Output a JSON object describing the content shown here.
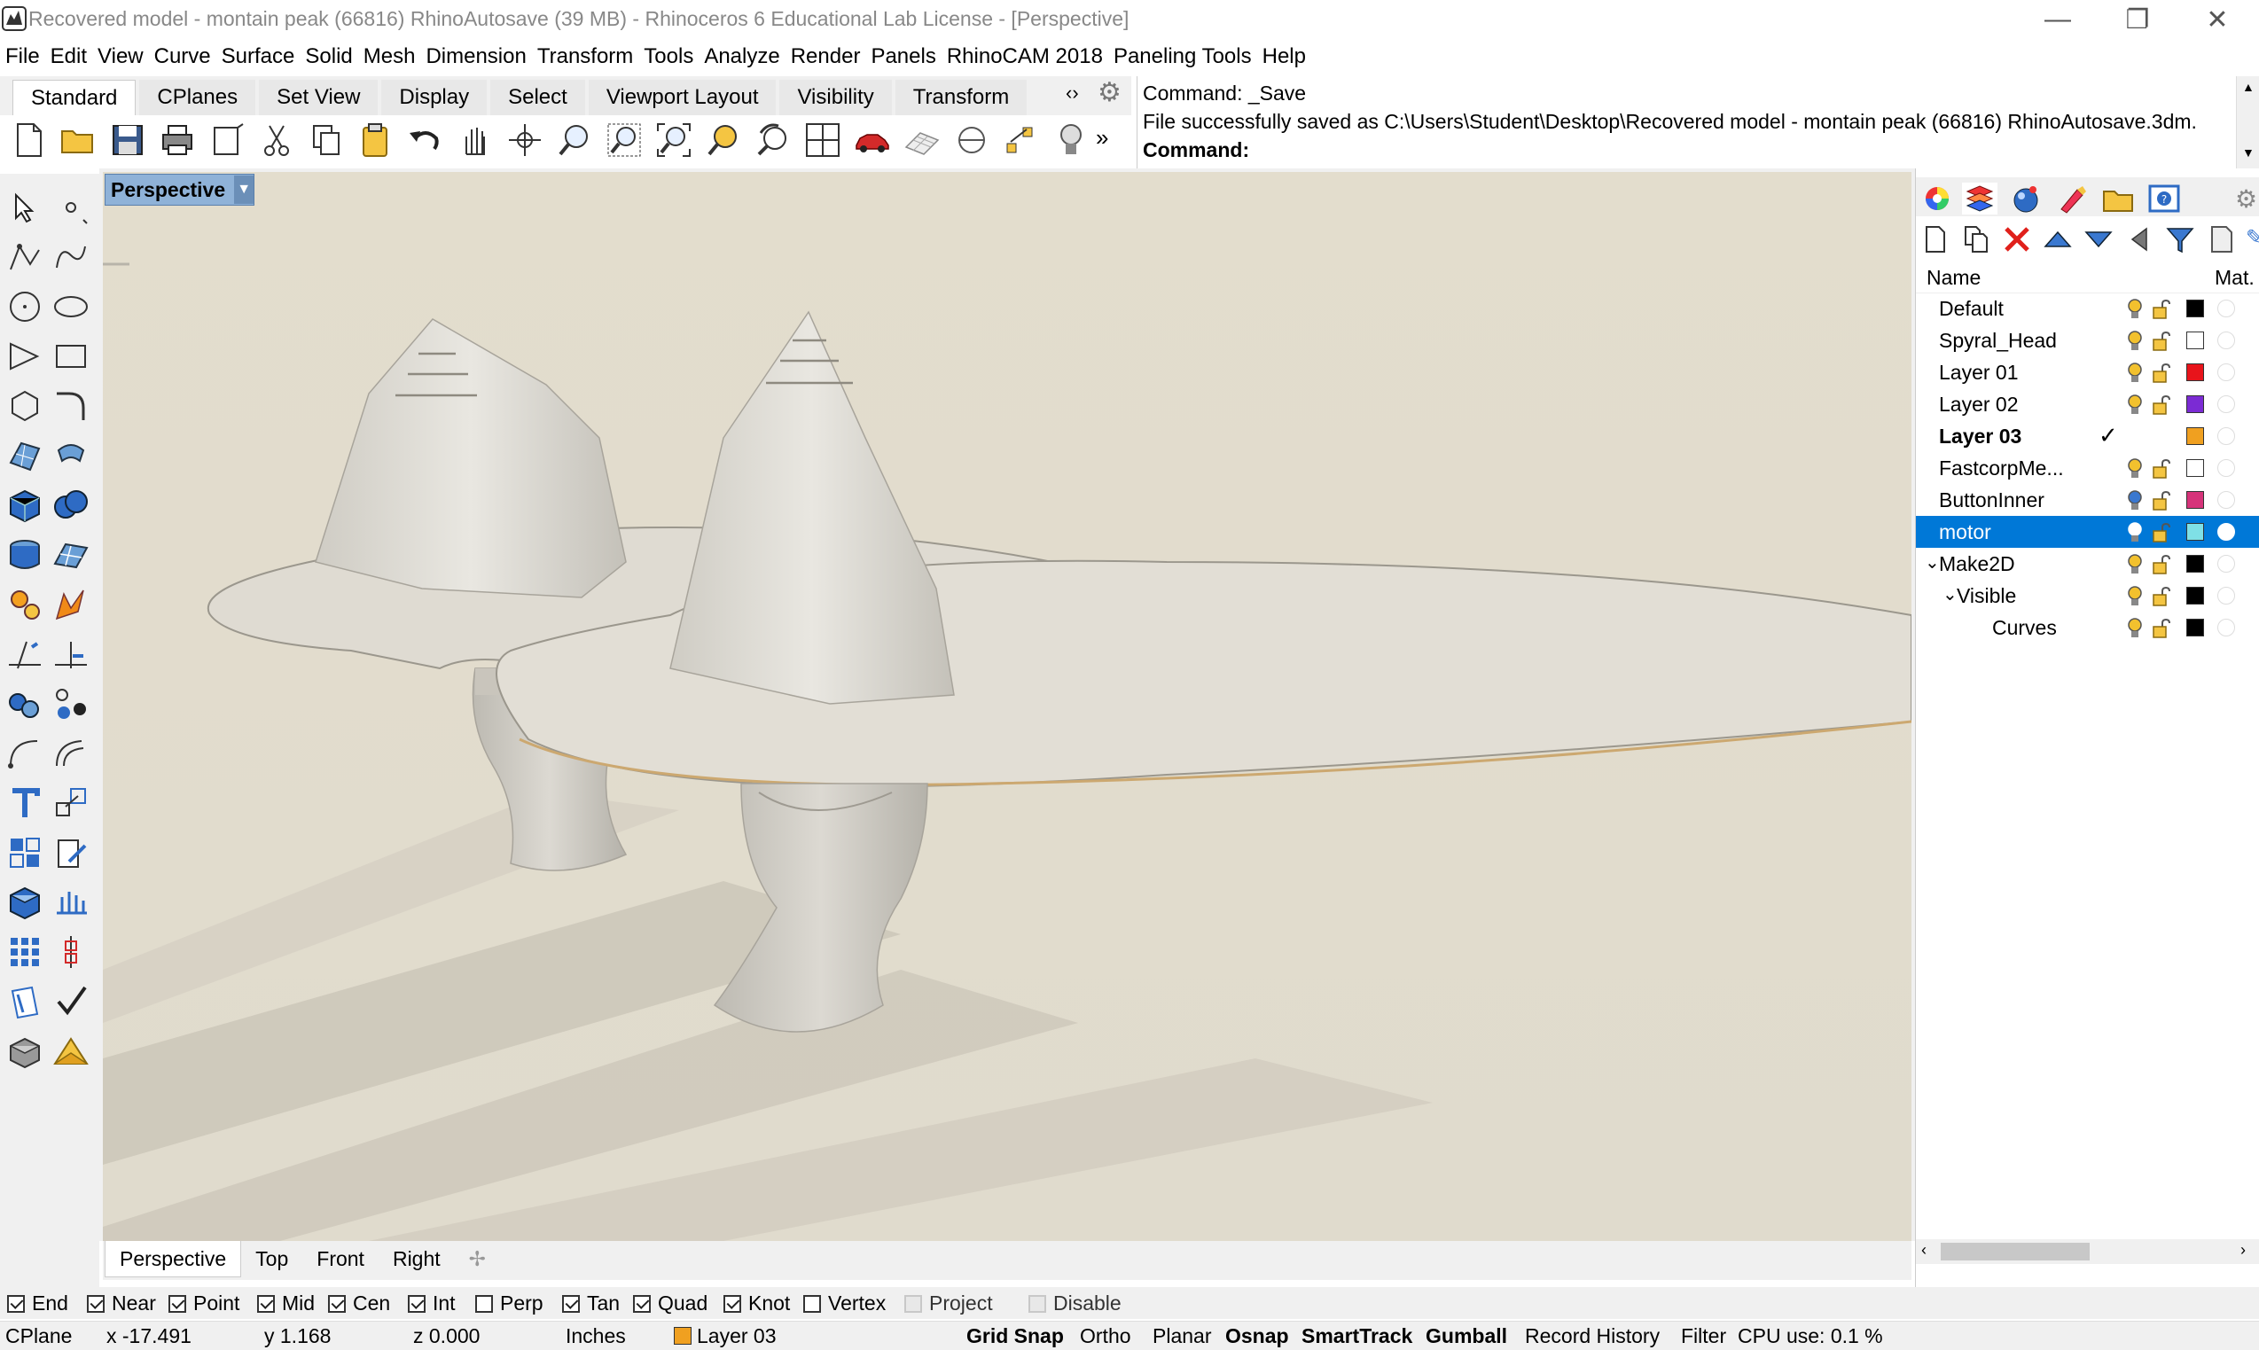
{
  "window": {
    "title": "Recovered model - montain peak (66816) RhinoAutosave (39 MB) - Rhinoceros 6 Educational Lab License - [Perspective]"
  },
  "menu": [
    "File",
    "Edit",
    "View",
    "Curve",
    "Surface",
    "Solid",
    "Mesh",
    "Dimension",
    "Transform",
    "Tools",
    "Analyze",
    "Render",
    "Panels",
    "RhinoCAM 2018",
    "Paneling Tools",
    "Help"
  ],
  "toolbar_tabs": [
    "Standard",
    "CPlanes",
    "Set View",
    "Display",
    "Select",
    "Viewport Layout",
    "Visibility",
    "Transform"
  ],
  "toolbar_more": "‹›",
  "command": {
    "line1": "Command: _Save",
    "line2": "File successfully saved as C:\\Users\\Student\\Desktop\\Recovered model - montain peak (66816) RhinoAutosave.3dm.",
    "prompt": "Command:"
  },
  "viewport": {
    "label": "Perspective"
  },
  "viewport_tabs": [
    "Perspective",
    "Top",
    "Front",
    "Right"
  ],
  "layers": {
    "columns": {
      "name": "Name",
      "material": "Mat."
    },
    "items": [
      {
        "name": "Default",
        "color": "#000000",
        "bold": false,
        "current": false,
        "selected": false,
        "indent": 0,
        "expander": "",
        "bulb": "#f2c12e"
      },
      {
        "name": "Spyral_Head",
        "color": "#ffffff",
        "bold": false,
        "current": false,
        "selected": false,
        "indent": 0,
        "expander": "",
        "bulb": "#f2c12e"
      },
      {
        "name": "Layer 01",
        "color": "#e8141b",
        "bold": false,
        "current": false,
        "selected": false,
        "indent": 0,
        "expander": "",
        "bulb": "#f2c12e"
      },
      {
        "name": "Layer 02",
        "color": "#7b2bd4",
        "bold": false,
        "current": false,
        "selected": false,
        "indent": 0,
        "expander": "",
        "bulb": "#f2c12e"
      },
      {
        "name": "Layer 03",
        "color": "#f0a020",
        "bold": true,
        "current": true,
        "selected": false,
        "indent": 0,
        "expander": "",
        "bulb": ""
      },
      {
        "name": "FastcorpMe...",
        "color": "#ffffff",
        "bold": false,
        "current": false,
        "selected": false,
        "indent": 0,
        "expander": "",
        "bulb": "#f2c12e"
      },
      {
        "name": "ButtonInner",
        "color": "#d6337a",
        "bold": false,
        "current": false,
        "selected": false,
        "indent": 0,
        "expander": "",
        "bulb": "#3a78d0"
      },
      {
        "name": "motor",
        "color": "#7fe0e6",
        "bold": false,
        "current": false,
        "selected": true,
        "indent": 0,
        "expander": "",
        "bulb": "#3a78d0"
      },
      {
        "name": "Make2D",
        "color": "#000000",
        "bold": false,
        "current": false,
        "selected": false,
        "indent": 0,
        "expander": "⌄",
        "bulb": "#f2c12e"
      },
      {
        "name": "Visible",
        "color": "#000000",
        "bold": false,
        "current": false,
        "selected": false,
        "indent": 1,
        "expander": "⌄",
        "bulb": "#f2c12e"
      },
      {
        "name": "Curves",
        "color": "#000000",
        "bold": false,
        "current": false,
        "selected": false,
        "indent": 2,
        "expander": "",
        "bulb": "#f2c12e"
      }
    ]
  },
  "osnaps": [
    {
      "label": "End",
      "checked": true
    },
    {
      "label": "Near",
      "checked": true
    },
    {
      "label": "Point",
      "checked": true
    },
    {
      "label": "Mid",
      "checked": true
    },
    {
      "label": "Cen",
      "checked": true
    },
    {
      "label": "Int",
      "checked": true
    },
    {
      "label": "Perp",
      "checked": false
    },
    {
      "label": "Tan",
      "checked": true
    },
    {
      "label": "Quad",
      "checked": true
    },
    {
      "label": "Knot",
      "checked": true
    },
    {
      "label": "Vertex",
      "checked": false
    },
    {
      "label": "Project",
      "checked": false,
      "disabled": true
    },
    {
      "label": "Disable",
      "checked": false,
      "disabled": true
    }
  ],
  "status": {
    "cplane": "CPlane",
    "x": "x -17.491",
    "y": "y 1.168",
    "z": "z 0.000",
    "units": "Inches",
    "layer": "Layer 03",
    "grid_snap": "Grid Snap",
    "ortho": "Ortho",
    "planar": "Planar",
    "osnap": "Osnap",
    "smarttrack": "SmartTrack",
    "gumball": "Gumball",
    "record_history": "Record History",
    "filter": "Filter",
    "cpu": "CPU use: 0.1 %"
  },
  "colors": {
    "viewport_bg": "#e2ddd0",
    "selection": "#0078d7",
    "viewport_label": "#8fb2d8"
  }
}
